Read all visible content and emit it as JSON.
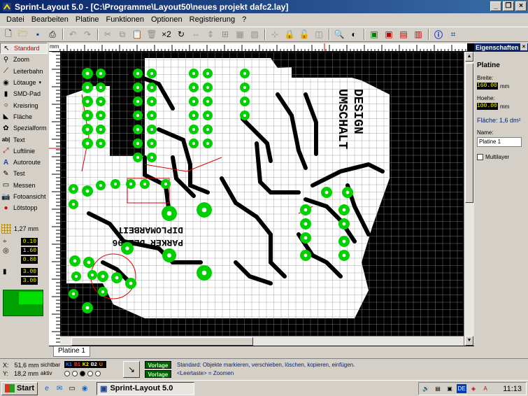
{
  "window": {
    "title": "Sprint-Layout 5.0 - [C:\\Programme\\Layout50\\neues projekt dafc2.lay]"
  },
  "menu": [
    "Datei",
    "Bearbeiten",
    "Platine",
    "Funktionen",
    "Optionen",
    "Registrierung",
    "?"
  ],
  "toolbar": {
    "zoom_factor_label": "×2"
  },
  "tools": [
    {
      "label": "Standard",
      "icon": "arrow-icon"
    },
    {
      "label": "Zoom",
      "icon": "magnifier-icon"
    },
    {
      "label": "Leiterbahn",
      "icon": "track-icon"
    },
    {
      "label": "Lötauge",
      "icon": "pad-icon"
    },
    {
      "label": "SMD-Pad",
      "icon": "smd-pad-icon"
    },
    {
      "label": "Kreisring",
      "icon": "circle-icon"
    },
    {
      "label": "Fläche",
      "icon": "polygon-icon"
    },
    {
      "label": "Spezialform",
      "icon": "special-form-icon"
    },
    {
      "label": "Text",
      "icon": "text-icon"
    },
    {
      "label": "Luftlinie",
      "icon": "airwire-icon"
    },
    {
      "label": "Autoroute",
      "icon": "autoroute-icon"
    },
    {
      "label": "Test",
      "icon": "test-icon"
    },
    {
      "label": "Messen",
      "icon": "ruler-icon"
    },
    {
      "label": "Fotoansicht",
      "icon": "camera-icon"
    },
    {
      "label": "Lötstopp",
      "icon": "solder-stop-icon"
    }
  ],
  "settings": {
    "grid": "1,27 mm",
    "track_width_top": "0.10",
    "pad_outer": "1.60",
    "pad_inner": "0.80",
    "smd_x": "3.00",
    "smd_y": "3.00"
  },
  "ruler": {
    "unit": "mm"
  },
  "board": {
    "tab": "Platine 1",
    "silk_text": [
      "DIPLOMARBEIT",
      "PARKER DEZ 96",
      "UMSCHALT",
      "DESIGN"
    ]
  },
  "properties": {
    "header": "Eigenschaften",
    "title": "Platine",
    "width_label": "Breite:",
    "width_value": "160.00",
    "height_label": "Hoehe:",
    "height_value": "100.00",
    "unit": "mm",
    "area": "Fläche: 1,6 dm²",
    "name_label": "Name:",
    "name_value": "Platine 1",
    "multilayer_label": "Multilayer"
  },
  "status": {
    "x_label": "X:",
    "x_value": "51,6 mm",
    "y_label": "Y:",
    "y_value": "18,2 mm",
    "visible_label": "sichtbar",
    "active_label": "aktiv",
    "layers": [
      {
        "name": "K1",
        "color": "#4080ff"
      },
      {
        "name": "B1",
        "color": "#ff4040"
      },
      {
        "name": "K2",
        "color": "#ffff00"
      },
      {
        "name": "B2",
        "color": "#ffffff"
      },
      {
        "name": "U",
        "color": "#ff8000"
      }
    ],
    "vorlage_1": "Vorlage",
    "vorlage_2": "Vorlage",
    "hint_line1": "Standard: Objekte markieren, verschieben, löschen, kopieren, einfügen.",
    "hint_line2": "<Leertaste> = Zoomen"
  },
  "taskbar": {
    "start": "Start",
    "task": "Sprint-Layout 5.0",
    "lang": "DE",
    "clock": "11:13"
  }
}
